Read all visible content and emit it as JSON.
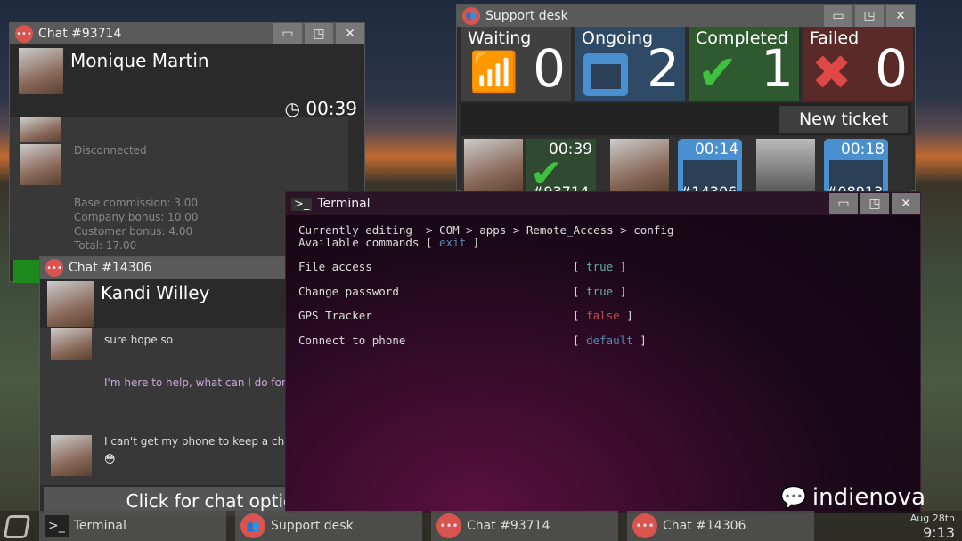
{
  "chat1": {
    "title": "Chat #93714",
    "name": "Monique Martin",
    "timer": "00:39",
    "status": "Disconnected",
    "summary": [
      "Base commission: 3.00",
      "Company bonus: 10.00",
      "Customer bonus: 4.00",
      "Total: 17.00"
    ]
  },
  "support": {
    "title": "Support desk",
    "cards": [
      {
        "label": "Waiting",
        "count": "0",
        "icon": "wifi-icon",
        "color": "#404040"
      },
      {
        "label": "Ongoing",
        "count": "2",
        "icon": "window-icon",
        "color": "#2e4a66"
      },
      {
        "label": "Completed",
        "count": "1",
        "icon": "check-icon",
        "color": "#2f5a30"
      },
      {
        "label": "Failed",
        "count": "0",
        "icon": "x-icon",
        "color": "#5a2a28"
      }
    ],
    "new_ticket": "New ticket",
    "tickets": [
      {
        "time": "00:39",
        "id": "#93714",
        "state": "check-icon"
      },
      {
        "time": "00:14",
        "id": "#14306",
        "state": "window-icon"
      },
      {
        "time": "00:18",
        "id": "#08913",
        "state": "window-icon"
      }
    ]
  },
  "chat2": {
    "title": "Chat #14306",
    "name": "Kandi Willey",
    "messages": [
      "sure hope so",
      "I'm here to help, what can I do for",
      "I can't get my phone to keep a cha"
    ],
    "emoji": "😳",
    "options": "Click for chat optic"
  },
  "terminal": {
    "title": "Terminal",
    "editing_label": "Currently editing",
    "path": "  > COM > apps > Remote_Access > config",
    "commands_label": "Available commands [ ",
    "command": "exit",
    "close": " ]",
    "settings": [
      {
        "name": "File access",
        "value": "true",
        "color": "#5fb0a0"
      },
      {
        "name": "Change password",
        "value": "true",
        "color": "#5fb0a0"
      },
      {
        "name": "GPS Tracker",
        "value": "false",
        "color": "#c05050"
      },
      {
        "name": "Connect to phone",
        "value": "default",
        "color": "#5a8ab0"
      }
    ]
  },
  "watermark": "indienova",
  "taskbar": {
    "items": [
      "Terminal",
      "Support desk",
      "Chat #93714",
      "Chat #14306"
    ],
    "date": "Aug 28th",
    "time": "9:13"
  }
}
